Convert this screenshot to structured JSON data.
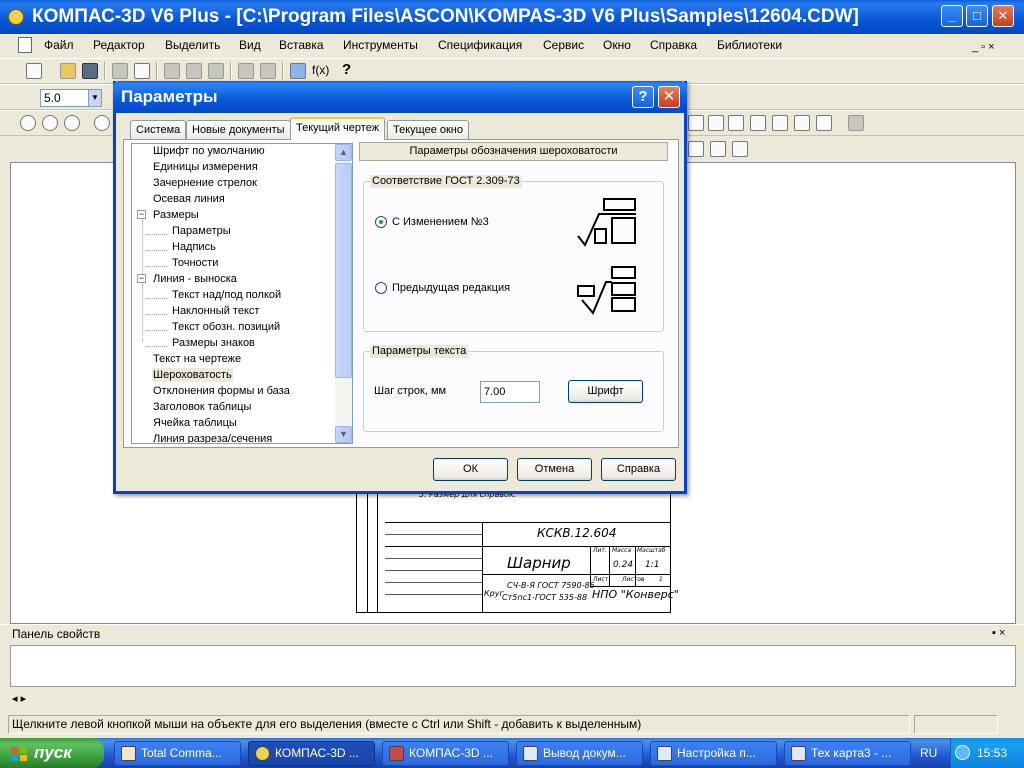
{
  "window": {
    "title": "КОМПАС-3D V6 Plus - [C:\\Program Files\\ASCON\\KOMPAS-3D V6 Plus\\Samples\\12604.CDW]",
    "minimize_glyph": "_",
    "maximize_glyph": "□",
    "close_glyph": "✕"
  },
  "menu": {
    "items": [
      "Файл",
      "Редактор",
      "Выделить",
      "Вид",
      "Вставка",
      "Инструменты",
      "Спецификация",
      "Сервис",
      "Окно",
      "Справка",
      "Библиотеки"
    ],
    "right_glyphs": "_ ▫ ×"
  },
  "toolbar": {
    "fx_label": "f(x)",
    "help_label": "?",
    "step_value": "5.0",
    "dropdown_glyph": "▼"
  },
  "dialog": {
    "title": "Параметры",
    "help_glyph": "?",
    "close_glyph": "✕",
    "tabs": [
      "Система",
      "Новые документы",
      "Текущий чертеж",
      "Текущее окно"
    ],
    "tree": [
      {
        "label": "Шрифт по умолчанию",
        "level": 0
      },
      {
        "label": "Единицы измерения",
        "level": 0
      },
      {
        "label": "Зачернение стрелок",
        "level": 0
      },
      {
        "label": "Осевая линия",
        "level": 0
      },
      {
        "label": "Размеры",
        "level": 0,
        "expanded": true
      },
      {
        "label": "Параметры",
        "level": 1
      },
      {
        "label": "Надпись",
        "level": 1
      },
      {
        "label": "Точности",
        "level": 1
      },
      {
        "label": "Линия - выноска",
        "level": 0,
        "expanded": true
      },
      {
        "label": "Текст над/под полкой",
        "level": 1
      },
      {
        "label": "Наклонный текст",
        "level": 1
      },
      {
        "label": "Текст обозн. позиций",
        "level": 1
      },
      {
        "label": "Размеры знаков",
        "level": 1
      },
      {
        "label": "Текст на чертеже",
        "level": 0
      },
      {
        "label": "Шероховатость",
        "level": 0,
        "selected": true
      },
      {
        "label": "Отклонения формы и база",
        "level": 0
      },
      {
        "label": "Заголовок таблицы",
        "level": 0
      },
      {
        "label": "Ячейка таблицы",
        "level": 0
      },
      {
        "label": "Линия разреза/сечения",
        "level": 0
      }
    ],
    "expander_glyph": "−",
    "scroll_up": "▲",
    "scroll_down": "▼",
    "section_title": "Параметры обозначения шероховатости",
    "gost_group": "Соответствие ГОСТ 2.309-73",
    "radio_new": "С Изменением №3",
    "radio_old": "Предыдущая редакция",
    "text_group": "Параметры текста",
    "line_step_label": "Шаг строк, мм",
    "line_step_value": "7.00",
    "font_button": "Шрифт",
    "ok": "ОК",
    "cancel": "Отмена",
    "help": "Справка"
  },
  "drawing": {
    "note": "3. Размер для справок.",
    "code": "КСКВ.12.604",
    "name": "Шарнир",
    "material_1": "СЧ-В-Я ГОСТ 7590-86",
    "material_2": "Ст5пс1-ГОСТ 535-88",
    "material_prefix": "Круг",
    "company": "НПО \"Конверс\"",
    "mass": "0.24",
    "scale": "1:1",
    "header_lit": "Лит.",
    "header_mass": "Масса",
    "header_scale": "Масштаб",
    "sheet_label": "Лист",
    "sheets_label": "Листов",
    "sheets_count": "1"
  },
  "panel": {
    "title": "Панель свойств",
    "pin_glyph": "▪ ×",
    "arrows": "◂ ▸"
  },
  "status": {
    "hint": "Щелкните левой кнопкой мыши на объекте для его выделения (вместе с Ctrl или Shift - добавить к выделенным)"
  },
  "taskbar": {
    "start": "пуск",
    "buttons": [
      "Total Comma...",
      "КОМПАС-3D ...",
      "КОМПАС-3D ...",
      "Вывод докум...",
      "Настройка п...",
      "Тех карта3 - ..."
    ],
    "lang": "RU",
    "time": "15:53"
  }
}
